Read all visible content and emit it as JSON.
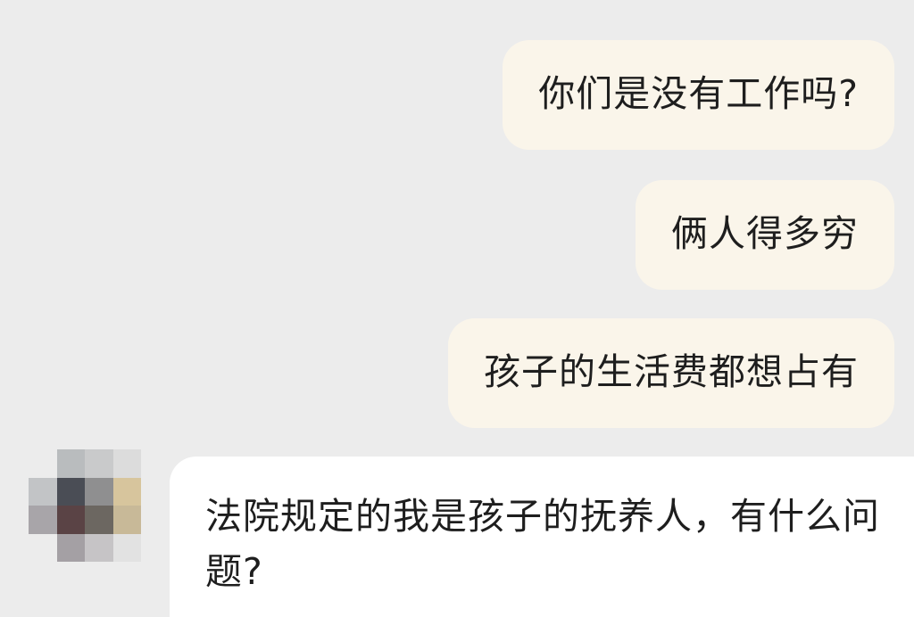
{
  "messages": {
    "outgoing": [
      "你们是没有工作吗?",
      "俩人得多穷",
      "孩子的生活费都想占有"
    ],
    "incoming": [
      "法院规定的我是孩子的抚养人，有什么问题?"
    ]
  },
  "colors": {
    "background": "#ececec",
    "outgoing_bubble": "#faf5ea",
    "incoming_bubble": "#ffffff",
    "text": "#1e1e1e"
  },
  "avatar": {
    "icon": "pixelated-avatar-icon"
  }
}
